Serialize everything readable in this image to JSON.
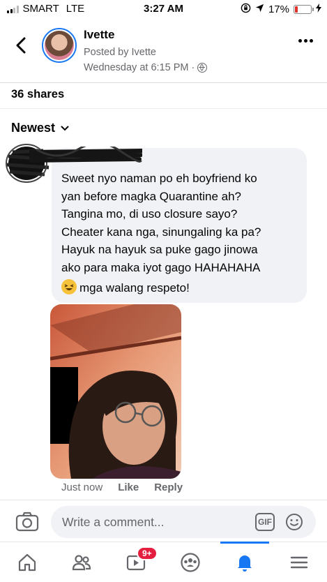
{
  "status_bar": {
    "carrier": "SMART",
    "network": "LTE",
    "time": "3:27 AM",
    "battery": "17%"
  },
  "post": {
    "author": "Ivette",
    "posted_by": "Posted by Ivette",
    "timestamp": "Wednesday at 6:15 PM ·",
    "shares": "36 shares",
    "sort_label": "Newest"
  },
  "comment": {
    "lines": [
      "Sweet nyo naman po eh boyfriend ko",
      "yan before magka Quarantine ah?",
      "Tangina mo, di uso closure sayo?",
      "Cheater kana nga, sinungaling ka pa?",
      "Hayuk na hayuk sa puke gago jinowa",
      "ako para maka iyot gago HAHAHAHA"
    ],
    "last_line": "mga walang respeto!",
    "time": "Just now",
    "like": "Like",
    "reply": "Reply"
  },
  "composer": {
    "placeholder": "Write a comment...",
    "gif_label": "GIF"
  },
  "nav": {
    "watch_badge": "9+",
    "active_tab": "notifications"
  },
  "colors": {
    "accent": "#1877f2",
    "badge": "#e41e3f",
    "bubble": "#f0f2f5"
  }
}
